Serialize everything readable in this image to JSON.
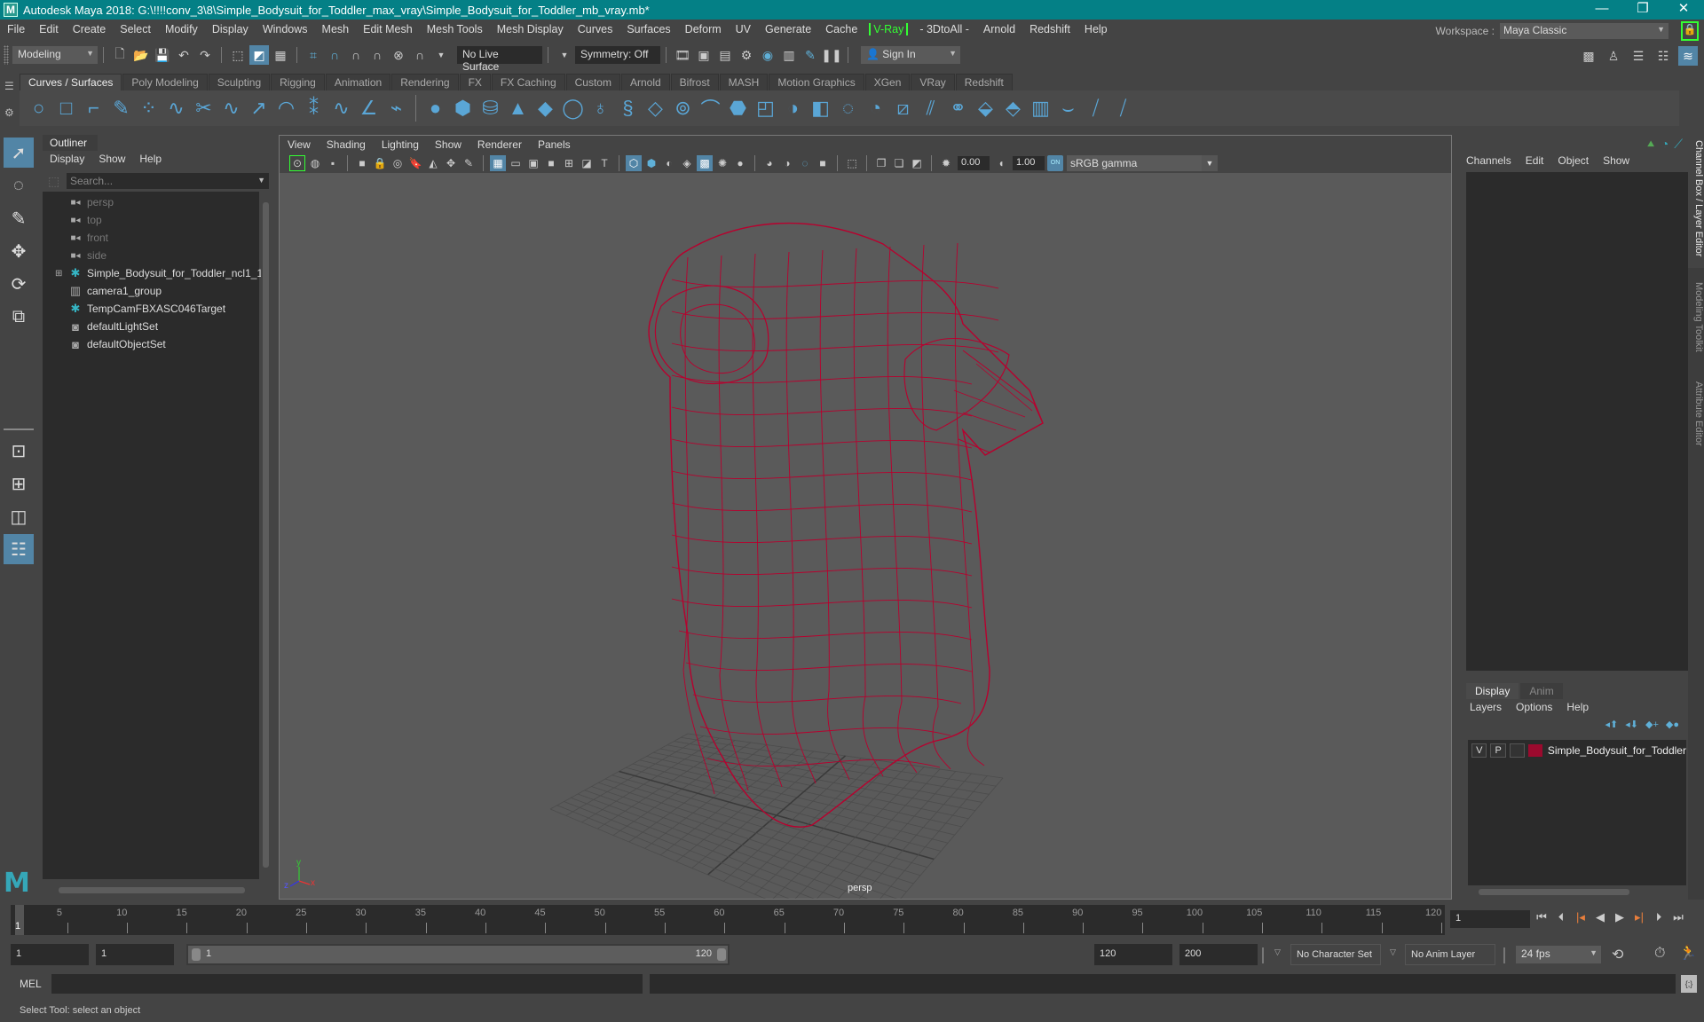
{
  "window": {
    "title": "Autodesk Maya 2018: G:\\!!!!conv_3\\8\\Simple_Bodysuit_for_Toddler_max_vray\\Simple_Bodysuit_for_Toddler_mb_vray.mb*",
    "logo": "M",
    "controls": {
      "minimize": "—",
      "maximize": "❐",
      "close": "✕"
    }
  },
  "menubar": {
    "items": [
      "File",
      "Edit",
      "Create",
      "Select",
      "Modify",
      "Display",
      "Windows",
      "Mesh",
      "Edit Mesh",
      "Mesh Tools",
      "Mesh Display",
      "Curves",
      "Surfaces",
      "Deform",
      "UV",
      "Generate",
      "Cache",
      "V-Ray",
      "- 3DtoAll -",
      "Arnold",
      "Redshift",
      "Help"
    ]
  },
  "workspace": {
    "label": "Workspace :",
    "value": "Maya Classic"
  },
  "statusline": {
    "menuset": "Modeling",
    "live_surface": "No Live Surface",
    "symmetry": "Symmetry: Off",
    "sign_in": "Sign In"
  },
  "shelf": {
    "tabs": [
      "Curves / Surfaces",
      "Poly Modeling",
      "Sculpting",
      "Rigging",
      "Animation",
      "Rendering",
      "FX",
      "FX Caching",
      "Custom",
      "Arnold",
      "Bifrost",
      "MASH",
      "Motion Graphics",
      "XGen",
      "VRay",
      "Redshift"
    ],
    "active_tab": "Curves / Surfaces",
    "icons": [
      "nurbs-circle",
      "nurbs-square",
      "ep-curve",
      "pencil-curve",
      "cv-curve",
      "bezier-curve",
      "curve-cut",
      "curve-fillet",
      "curve-extend",
      "arc",
      "offset-curve",
      "rebuild-curve",
      "attach-curve",
      "detach-curve",
      "sep",
      "nurbs-sphere",
      "nurbs-cube",
      "nurbs-cylinder",
      "nurbs-cone",
      "nurbs-plane",
      "nurbs-torus",
      "revolve",
      "loft",
      "planar",
      "extrude",
      "birail",
      "boundary",
      "square-surface",
      "bevel-plus",
      "project-curve",
      "intersect",
      "trim",
      "untrim",
      "attach-surface",
      "detach-surface",
      "fillet",
      "insert-isoparm",
      "extend-surface",
      "rebuild-surface",
      "sculpt-surface",
      "stitch"
    ]
  },
  "toolbox": {
    "tools": [
      "select-tool",
      "lasso-tool",
      "paint-select-tool",
      "move-tool",
      "rotate-tool",
      "scale-tool"
    ],
    "layouts": [
      "single-perspective-layout",
      "four-view-layout",
      "persp-outliner-layout",
      "outliner-layout"
    ]
  },
  "outliner": {
    "title": "Outliner",
    "menus": [
      "Display",
      "Show",
      "Help"
    ],
    "search_placeholder": "Search...",
    "items": [
      {
        "label": "persp",
        "icon": "camera",
        "dim": true,
        "expandable": false
      },
      {
        "label": "top",
        "icon": "camera",
        "dim": true,
        "expandable": false
      },
      {
        "label": "front",
        "icon": "camera",
        "dim": true,
        "expandable": false
      },
      {
        "label": "side",
        "icon": "camera",
        "dim": true,
        "expandable": false
      },
      {
        "label": "Simple_Bodysuit_for_Toddler_ncl1_1",
        "icon": "transform",
        "dim": false,
        "expandable": true
      },
      {
        "label": "camera1_group",
        "icon": "group",
        "dim": false,
        "expandable": false
      },
      {
        "label": "TempCamFBXASC046Target",
        "icon": "transform",
        "dim": false,
        "expandable": false
      },
      {
        "label": "defaultLightSet",
        "icon": "set",
        "dim": false,
        "expandable": false
      },
      {
        "label": "defaultObjectSet",
        "icon": "set",
        "dim": false,
        "expandable": false
      }
    ]
  },
  "viewport": {
    "menus": [
      "View",
      "Shading",
      "Lighting",
      "Show",
      "Renderer",
      "Panels"
    ],
    "exposure": "0.00",
    "gamma": "1.00",
    "color_space": "sRGB gamma",
    "camera_label": "persp",
    "axis": {
      "x": "x",
      "y": "y",
      "z": "z"
    },
    "wire_color": "#b8002e"
  },
  "channel_box": {
    "menus": [
      "Channels",
      "Edit",
      "Object",
      "Show"
    ]
  },
  "layer_editor": {
    "tabs": [
      "Display",
      "Anim"
    ],
    "active_tab": "Display",
    "menus": [
      "Layers",
      "Options",
      "Help"
    ],
    "layers": [
      {
        "visible": "V",
        "playback": "P",
        "name": "Simple_Bodysuit_for_Toddler",
        "color": "#9b0a2e"
      }
    ]
  },
  "side_tabs": [
    "Channel Box / Layer Editor",
    "Modeling Toolkit",
    "Attribute Editor"
  ],
  "timeline": {
    "ticks": [
      5,
      10,
      15,
      20,
      25,
      30,
      35,
      40,
      45,
      50,
      55,
      60,
      65,
      70,
      75,
      80,
      85,
      90,
      95,
      100,
      105,
      110,
      115,
      120
    ],
    "start": 1,
    "end": 120,
    "current_frame_marker": "1",
    "current_frame": "1"
  },
  "range": {
    "start_time": "1",
    "playback_start": "1",
    "slider_min": "1",
    "slider_max": "120",
    "playback_end": "120",
    "end_time": "200",
    "character_set": "No Character Set",
    "anim_layer": "No Anim Layer",
    "fps": "24 fps"
  },
  "command_line": {
    "label": "MEL"
  },
  "help_line": {
    "text": "Select Tool: select an object"
  }
}
